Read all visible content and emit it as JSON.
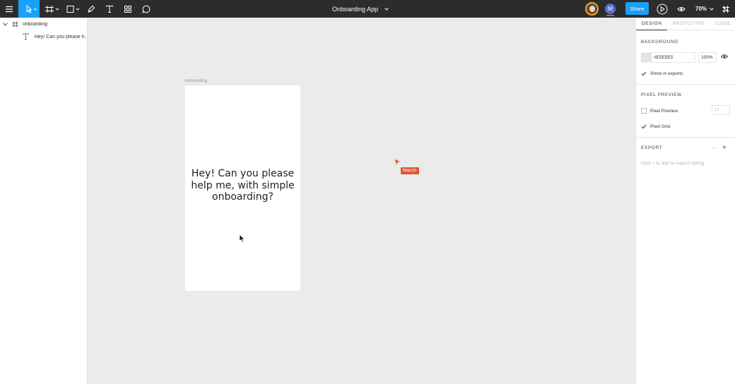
{
  "toolbar": {
    "document_title": "Onboarding App",
    "share_label": "Share",
    "zoom_label": "70%",
    "collaborator_initial": "M",
    "accent_color": "#18a0fb",
    "bar_color": "#2c2c2c",
    "icons": [
      "menu-icon",
      "move-tool-icon",
      "frame-tool-icon",
      "shape-tool-icon",
      "pen-tool-icon",
      "text-tool-icon",
      "components-icon",
      "comment-icon",
      "play-icon",
      "eye-icon",
      "resize-icon"
    ]
  },
  "layers": {
    "items": [
      {
        "name": "onboarding",
        "type": "frame"
      },
      {
        "name": "Hey! Can you please h...",
        "type": "text"
      }
    ]
  },
  "canvas": {
    "frame_label": "onboarding",
    "frame_text": "Hey! Can you please help me, with simple onboarding?",
    "collaborator_cursor_name": "Marcin",
    "collaborator_cursor_color": "#e0562f",
    "background_color": "#ebebeb"
  },
  "inspector": {
    "tabs": [
      "DESIGN",
      "PROTOTYPE",
      "CODE"
    ],
    "active_tab": "DESIGN",
    "background": {
      "title": "BACKGROUND",
      "hex_value": "#E5E5E5",
      "opacity": "100%",
      "show_in_exports_label": "Show in exports",
      "show_in_exports_checked": true
    },
    "pixel_preview": {
      "title": "PIXEL PREVIEW",
      "preview_label": "Pixel Preview",
      "preview_checked": false,
      "grid_label": "Pixel Grid",
      "grid_checked": true,
      "scale_value": "1x"
    },
    "export": {
      "title": "EXPORT",
      "minus": "−",
      "plus": "+",
      "hint": "Click + to add an export setting"
    }
  }
}
